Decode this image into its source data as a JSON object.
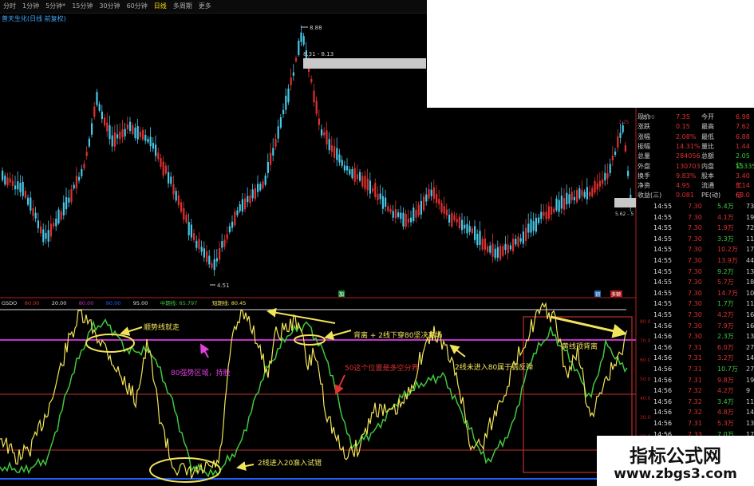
{
  "toolbar": {
    "items": [
      "分时",
      "1分钟",
      "5分钟*",
      "15分钟",
      "30分钟",
      "60分钟",
      "日线",
      "多周期",
      "更多"
    ],
    "active_index": 6
  },
  "chart": {
    "title": "普天生化(日线 前复权)",
    "high_label": "8.88",
    "high_range_label": "8.31 - 8.13",
    "low_label": "4.51",
    "side_label": "5.62 - 5",
    "axis_marker": "8.00",
    "axis_marker2": "7.25",
    "bottom_markers": [
      "加",
      "钥",
      "多顿"
    ]
  },
  "indicator": {
    "header": [
      "GSDO",
      "80.00",
      "20.00",
      "80.00",
      "90.00",
      "95.00",
      "中期线: 65.797",
      "短期线: 80.45"
    ],
    "annotations": {
      "a1": "顺势线就走",
      "a2": "背离 + 2线下穿80坚决离场",
      "a3": "80强势区域，持股",
      "a4": "50这个位置是多空分界",
      "a5": "2线未进入80属于弱反弹",
      "a6": "黄线顶背离",
      "a7": "2线进入20准入试错"
    },
    "right_scale": [
      "80.0",
      "70.0",
      "60.0",
      "50.0",
      "40.0",
      "30.0",
      "20.0",
      "10.0"
    ]
  },
  "colors": {
    "up": "#e03030",
    "down": "#48c8e8",
    "yellow": "#f2e45a",
    "green": "#3ec83e",
    "magenta": "#c030c8",
    "blue": "#2060ff"
  },
  "quote": {
    "rows": [
      {
        "a": "现价",
        "b": "7.35",
        "c": "今开",
        "d": "6.98"
      },
      {
        "a": "涨跌",
        "b": "0.15",
        "c": "最高",
        "d": "7.62"
      },
      {
        "a": "涨幅",
        "b": "2.08%",
        "c": "最低",
        "d": "6.88"
      },
      {
        "a": "振幅",
        "b": "14.31%",
        "c": "量比",
        "d": "1.44"
      },
      {
        "a": "总量",
        "b": "284056",
        "c": "总额",
        "d": "2.05亿"
      },
      {
        "a": "外盘",
        "b": "130703",
        "c": "内盘",
        "d": "153353"
      },
      {
        "a": "换手",
        "b": "9.83%",
        "c": "股本",
        "d": "3.40亿"
      },
      {
        "a": "净资",
        "b": "4.95",
        "c": "流通",
        "d": "3.14亿"
      },
      {
        "a": "收益(三)",
        "b": "0.081",
        "c": "PE(动)",
        "d": "68.0"
      }
    ],
    "trades": [
      {
        "t": "14:55",
        "p": "7.30",
        "v": "5.4万",
        "n": "73"
      },
      {
        "t": "14:55",
        "p": "7.30",
        "v": "4.1万",
        "n": "19"
      },
      {
        "t": "14:55",
        "p": "7.30",
        "v": "1.9万",
        "n": "72"
      },
      {
        "t": "14:55",
        "p": "7.30",
        "v": "3.3万",
        "n": "11"
      },
      {
        "t": "14:55",
        "p": "7.30",
        "v": "10.2万",
        "n": "17"
      },
      {
        "t": "14:55",
        "p": "7.30",
        "v": "13.9万",
        "n": "44"
      },
      {
        "t": "14:55",
        "p": "7.30",
        "v": "9.2万",
        "n": "13"
      },
      {
        "t": "14:55",
        "p": "7.30",
        "v": "5.7万",
        "n": "18"
      },
      {
        "t": "14:55",
        "p": "7.30",
        "v": "14.7万",
        "n": "10"
      },
      {
        "t": "14:55",
        "p": "7.30",
        "v": "1.7万",
        "n": "11"
      },
      {
        "t": "14:55",
        "p": "7.30",
        "v": "4.2万",
        "n": "16"
      },
      {
        "t": "14:56",
        "p": "7.30",
        "v": "7.9万",
        "n": "16"
      },
      {
        "t": "14:56",
        "p": "7.30",
        "v": "2.3万",
        "n": "13"
      },
      {
        "t": "14:56",
        "p": "7.31",
        "v": "6.0万",
        "n": "27"
      },
      {
        "t": "14:56",
        "p": "7.31",
        "v": "3.2万",
        "n": "14"
      },
      {
        "t": "14:56",
        "p": "7.31",
        "v": "10.7万",
        "n": "27"
      },
      {
        "t": "14:56",
        "p": "7.31",
        "v": "9.8万",
        "n": "19"
      },
      {
        "t": "14:56",
        "p": "7.32",
        "v": "4.2万",
        "n": "9"
      },
      {
        "t": "14:56",
        "p": "7.32",
        "v": "3.4万",
        "n": "11"
      },
      {
        "t": "14:56",
        "p": "7.32",
        "v": "4.8万",
        "n": "14"
      },
      {
        "t": "14:56",
        "p": "7.31",
        "v": "5.3万",
        "n": "13"
      },
      {
        "t": "14:56",
        "p": "7.33",
        "v": "7.0万",
        "n": "17"
      },
      {
        "t": "14:56",
        "p": "7.33",
        "v": "5.5万",
        "n": "10"
      },
      {
        "t": "14:56",
        "p": "7.33",
        "v": "1.9万",
        "n": "16"
      },
      {
        "t": "14:56",
        "p": "7.32",
        "v": "2.4万",
        "n": "11"
      },
      {
        "t": "14:56",
        "p": "7.33",
        "v": "2.6万",
        "n": "15"
      }
    ]
  },
  "watermark": {
    "line1": "指标公式网",
    "line2": "www.zbgs3.com"
  }
}
